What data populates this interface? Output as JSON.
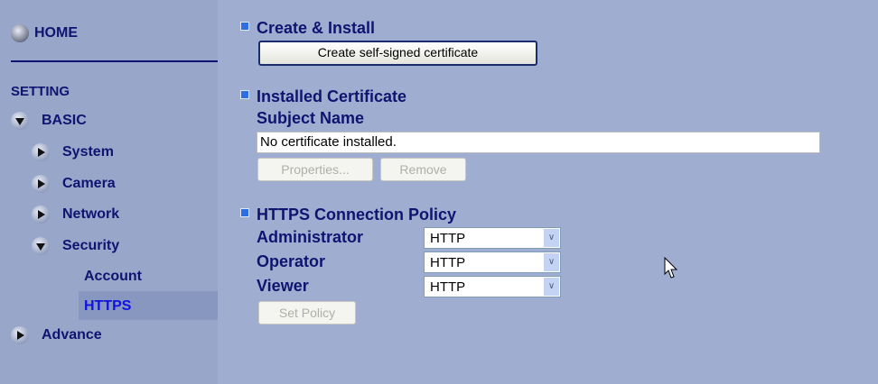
{
  "sidebar": {
    "home": "HOME",
    "setting": "SETTING",
    "basic": "BASIC",
    "system": "System",
    "camera": "Camera",
    "network": "Network",
    "security": "Security",
    "account": "Account",
    "https": "HTTPS",
    "advance": "Advance"
  },
  "create": {
    "title": "Create & Install",
    "button": "Create self-signed certificate"
  },
  "installed": {
    "title": "Installed Certificate",
    "subject_label": "Subject Name",
    "subject_value": "No certificate installed.",
    "properties": "Properties...",
    "remove": "Remove"
  },
  "policy": {
    "title": "HTTPS Connection Policy",
    "administrator": "Administrator",
    "operator": "Operator",
    "viewer": "Viewer",
    "admin_value": "HTTP",
    "operator_value": "HTTP",
    "viewer_value": "HTTP",
    "set": "Set Policy"
  },
  "colors": {
    "nav": "#101470",
    "selected": "#1010e0"
  }
}
